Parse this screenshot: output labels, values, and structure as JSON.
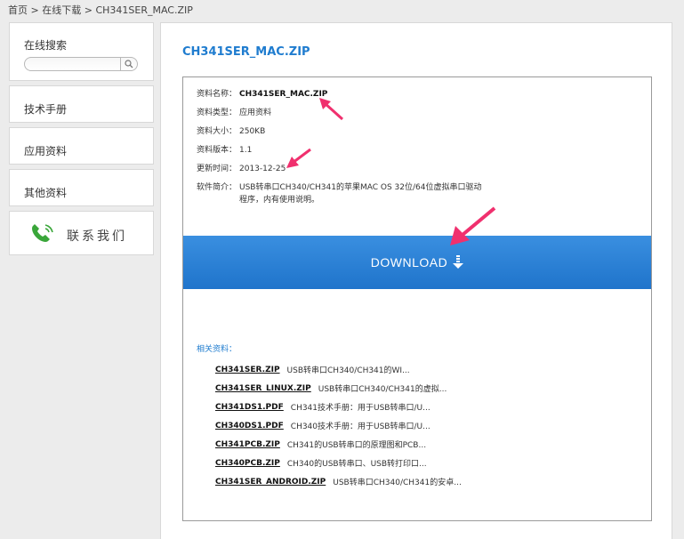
{
  "breadcrumb": {
    "home": "首页",
    "sep1": ">",
    "section": "在线下载",
    "sep2": ">",
    "current": "CH341SER_MAC.ZIP"
  },
  "sidebar": {
    "search_title": "在线搜索",
    "search_placeholder": "",
    "items": [
      {
        "label": "技术手册"
      },
      {
        "label": "应用资料"
      },
      {
        "label": "其他资料"
      }
    ],
    "contact_label": "联系我们"
  },
  "main": {
    "title": "CH341SER_MAC.ZIP",
    "info": {
      "name_label": "资料名称：",
      "name_value": "CH341SER_MAC.ZIP",
      "type_label": "资料类型：",
      "type_value": "应用资料",
      "size_label": "资料大小：",
      "size_value": "250KB",
      "version_label": "资料版本：",
      "version_value": "1.1",
      "updated_label": "更新时间：",
      "updated_value": "2013-12-25",
      "summary_label": "软件简介：",
      "summary_value": "USB转串口CH340/CH341的苹果MAC OS 32位/64位虚拟串口驱动程序，内有使用说明。"
    },
    "download_label": "DOWNLOAD",
    "related_title": "相关资料：",
    "related": [
      {
        "name": "CH341SER.ZIP",
        "desc": "USB转串口CH340/CH341的WI..."
      },
      {
        "name": "CH341SER_LINUX.ZIP",
        "desc": "USB转串口CH340/CH341的虚拟..."
      },
      {
        "name": "CH341DS1.PDF",
        "desc": "CH341技术手册：用于USB转串口/U..."
      },
      {
        "name": "CH340DS1.PDF",
        "desc": "CH340技术手册：用于USB转串口/U..."
      },
      {
        "name": "CH341PCB.ZIP",
        "desc": "CH341的USB转串口的原理图和PCB..."
      },
      {
        "name": "CH340PCB.ZIP",
        "desc": "CH340的USB转串口、USB转打印口..."
      },
      {
        "name": "CH341SER_ANDROID.ZIP",
        "desc": "USB转串口CH340/CH341的安卓..."
      }
    ]
  },
  "colors": {
    "accent": "#1f7ccf",
    "download_bar": "#2a82d8",
    "annotation_arrow": "#f0306e"
  }
}
